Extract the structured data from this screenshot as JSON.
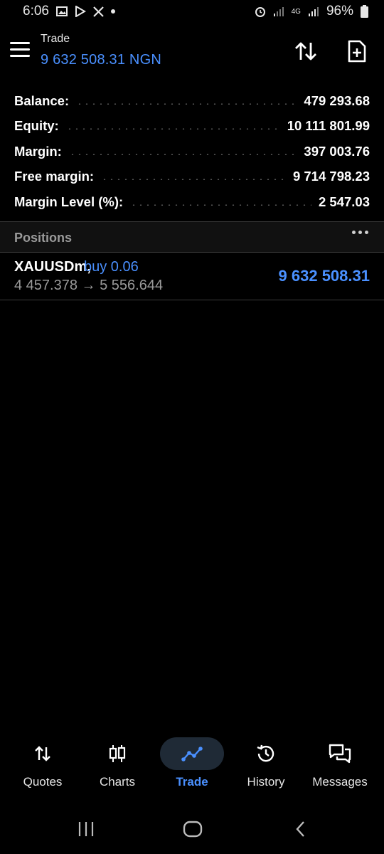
{
  "status_bar": {
    "time": "6:06",
    "battery": "96%",
    "network": "4G"
  },
  "header": {
    "title": "Trade",
    "subtitle": "9 632 508.31 NGN"
  },
  "summary": [
    {
      "label": "Balance:",
      "value": "479 293.68"
    },
    {
      "label": "Equity:",
      "value": "10 111 801.99"
    },
    {
      "label": "Margin:",
      "value": "397 003.76"
    },
    {
      "label": "Free margin:",
      "value": "9 714 798.23"
    },
    {
      "label": "Margin Level (%):",
      "value": "2 547.03"
    }
  ],
  "positions": {
    "title": "Positions",
    "items": [
      {
        "symbol": "XAUUSDm,",
        "side": "buy 0.06",
        "prices": "4 457.378 → 5 556.644",
        "profit": "9 632 508.31"
      }
    ]
  },
  "bottom_nav": [
    {
      "label": "Quotes",
      "icon": "quotes-icon"
    },
    {
      "label": "Charts",
      "icon": "charts-icon"
    },
    {
      "label": "Trade",
      "icon": "trade-icon",
      "active": true
    },
    {
      "label": "History",
      "icon": "history-icon"
    },
    {
      "label": "Messages",
      "icon": "messages-icon"
    }
  ],
  "colors": {
    "accent": "#4a90ff",
    "background": "#000000",
    "muted": "#9a9a9a"
  }
}
